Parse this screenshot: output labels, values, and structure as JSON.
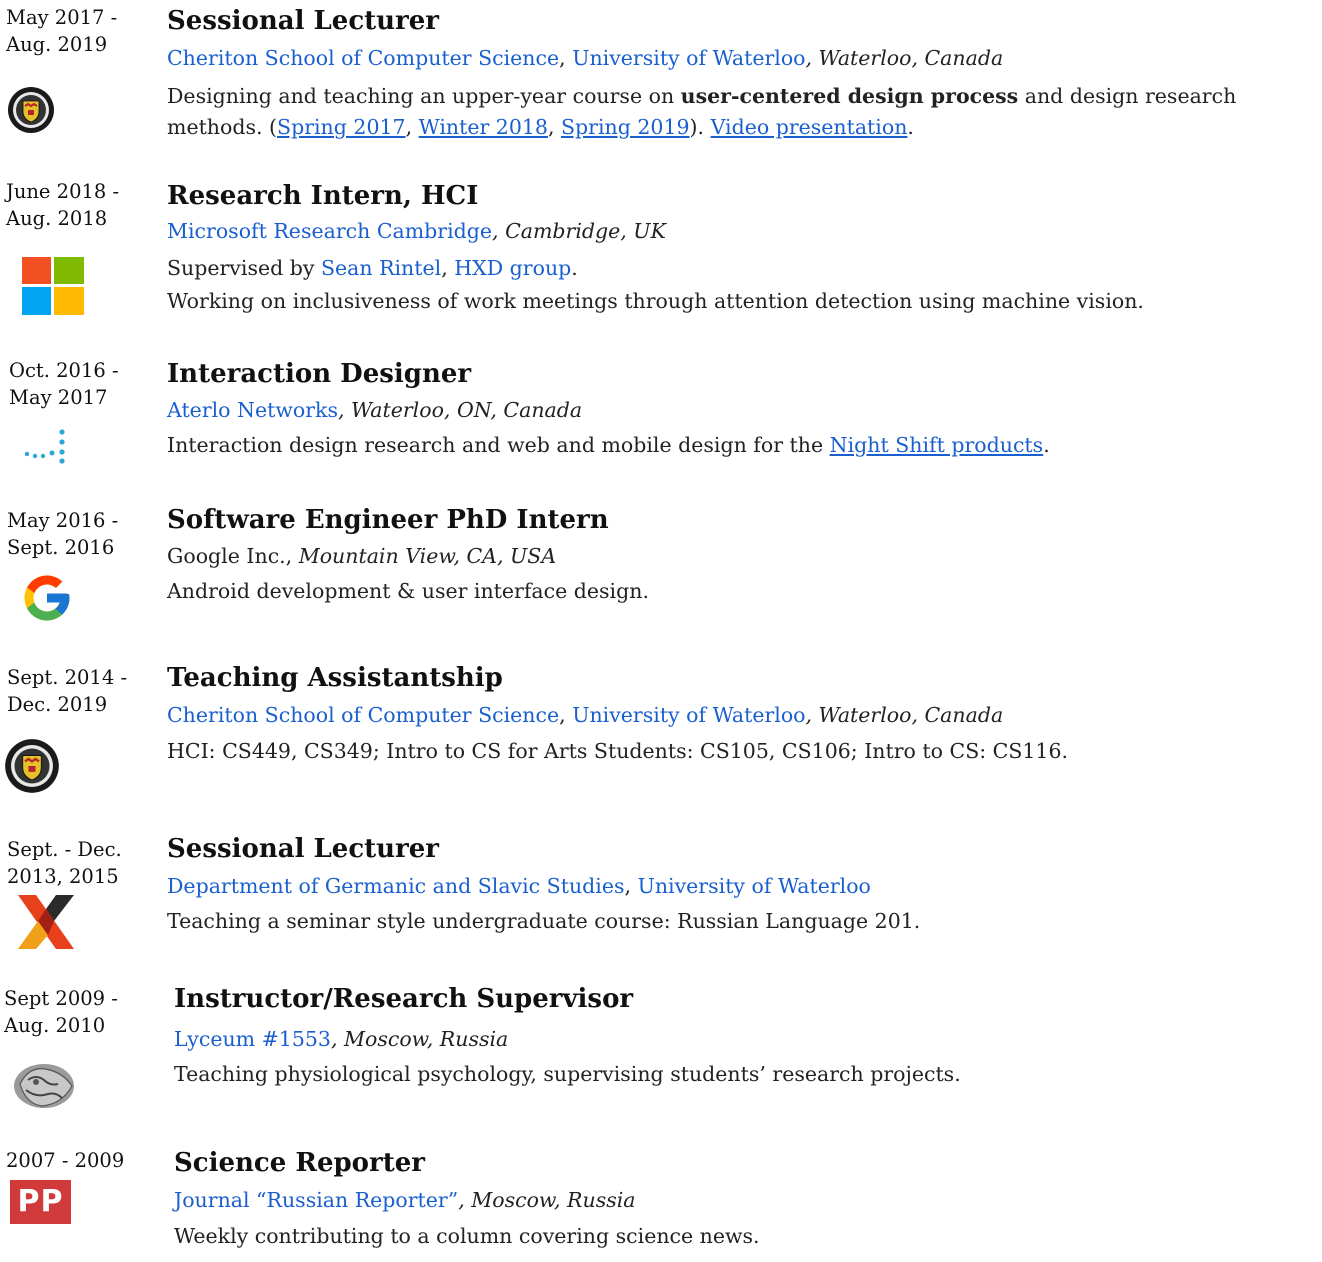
{
  "entries": [
    {
      "date1": "May 2017 -",
      "date2": "Aug. 2019",
      "logo": "university-of-waterloo-crest",
      "title": "Sessional Lecturer",
      "org1": "Cheriton School of Computer Science",
      "sep1": ",",
      "org2": "University of Waterloo",
      "place": ", Waterloo, Canada",
      "desc_a": "Designing and teaching an upper-year course on ",
      "desc_bold": "user-centered design process",
      "desc_b": " and design research",
      "desc2_a": "methods. (",
      "link_spring2017": "Spring 2017",
      "c1": ", ",
      "link_winter2018": "Winter 2018",
      "c2": ", ",
      "link_spring2019": "Spring 2019",
      "c3": "). ",
      "link_video": "Video presentation",
      "c4": "."
    },
    {
      "date1": "June 2018 -",
      "date2": "Aug. 2018",
      "logo": "microsoft-logo",
      "title": "Research Intern, HCI",
      "org1": "Microsoft Research Cambridge",
      "place": ", Cambridge, UK",
      "sup_a": "Supervised by ",
      "link_sean": "Sean Rintel",
      "sup_b": ", ",
      "link_hxd": "HXD group",
      "sup_c": ".",
      "desc": "Working on inclusiveness of work meetings through attention detection using machine vision."
    },
    {
      "date1": "Oct. 2016 -",
      "date2": "May 2017",
      "logo": "aterlo-dots-logo",
      "title": "Interaction Designer",
      "org1": "Aterlo Networks",
      "place": ", Waterloo, ON, Canada",
      "desc_a": "Interaction design research and web and mobile design for the ",
      "link_night": "Night Shift products",
      "desc_b": "."
    },
    {
      "date1": "May 2016 -",
      "date2": "Sept. 2016",
      "logo": "google-g-logo",
      "title": "Software Engineer PhD Intern",
      "org_plain": "Google Inc., ",
      "place": "Mountain View, CA, USA",
      "desc": "Android development & user interface design."
    },
    {
      "date1": "Sept. 2014 -",
      "date2": "Dec. 2019",
      "logo": "university-of-waterloo-crest",
      "title": "Teaching Assistantship",
      "org1": "Cheriton School of Computer Science",
      "sep1": ",",
      "org2": "University of Waterloo",
      "place": ", Waterloo, Canada",
      "desc": "HCI: CS449, CS349; Intro to CS for Arts Students: CS105, CS106; Intro to CS: CS116."
    },
    {
      "date1": "Sept. - Dec.",
      "date2": "2013, 2015",
      "logo": "germanic-slavic-x-logo",
      "title": "Sessional Lecturer",
      "org1": "Department of Germanic and Slavic Studies",
      "sep1": ",",
      "org2": "University of Waterloo",
      "desc": "Teaching a seminar style undergraduate course: Russian Language 201."
    },
    {
      "date1": "Sept 2009 -",
      "date2": "Aug. 2010",
      "logo": "lyceum-emblem",
      "title": "Instructor/Research Supervisor",
      "org1": "Lyceum #1553",
      "place": ", Moscow, Russia",
      "desc": "Teaching physiological psychology, supervising students’ research projects."
    },
    {
      "date1": "2007 - 2009",
      "logo": "russian-reporter-pp-logo",
      "logo_text": "PP",
      "title": "Science Reporter",
      "org1": "Journal “Russian Reporter”",
      "place": ", Moscow, Russia",
      "desc": "Weekly contributing to a column covering science news."
    }
  ],
  "colors": {
    "link": "#1a5fcf",
    "text": "#222222",
    "pp_red": "#d03a3a"
  }
}
